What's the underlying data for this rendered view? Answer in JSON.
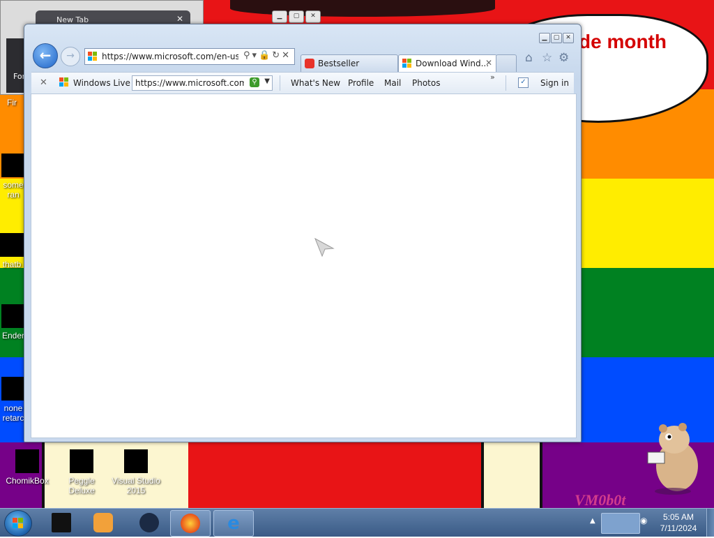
{
  "desktop": {
    "speech_bubble": [
      "de month",
      "!"
    ],
    "watermark": "VM0b0t",
    "icons": [
      {
        "label": "Fir"
      },
      {
        "label": "some",
        "sub": "ran"
      },
      {
        "label": "thatb"
      },
      {
        "label": "Ender"
      },
      {
        "label": "none",
        "sub": "retarc"
      },
      {
        "label": "ChomikBox"
      },
      {
        "label": "Peggle Deluxe"
      },
      {
        "label": "Visual Studio",
        "sub": "2015"
      }
    ]
  },
  "firefox_window": {
    "tab_title": "New Tab",
    "sidebar_label": "For"
  },
  "ie": {
    "address": "https://www.microsoft.com/en-us/s",
    "tabs": [
      {
        "title": "Bestseller",
        "active": false,
        "icon_color": "#e8332a"
      },
      {
        "title": "Download Wind...",
        "active": true,
        "icon_color": "#00a4ef"
      }
    ],
    "command_bar": {
      "windows_live": "Windows Live",
      "search_value": "https://www.microsoft.com/e",
      "links": [
        "What's New",
        "Profile",
        "Mail",
        "Photos"
      ],
      "sign_in": "Sign in"
    }
  },
  "taskbar": {
    "clock_time": "5:05 AM",
    "clock_date": "7/11/2024"
  },
  "colors": {
    "ms_red": "#f25022",
    "ms_green": "#7fba00",
    "ms_blue": "#00a4ef",
    "ms_yellow": "#ffb900",
    "ie_frame": "#c9d9ee"
  }
}
